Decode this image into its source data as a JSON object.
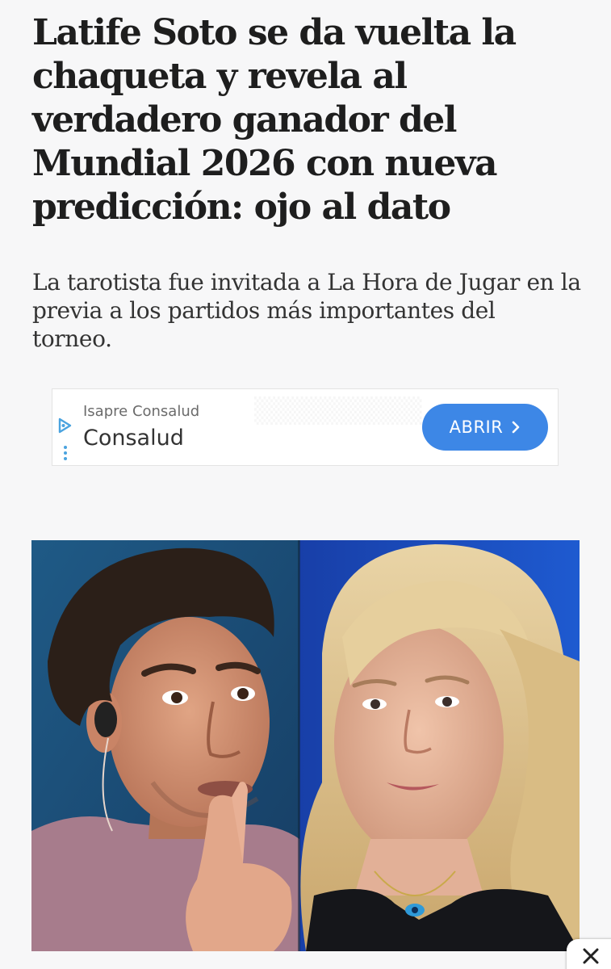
{
  "article": {
    "headline": "Latife Soto se da vuelta la chaqueta y revela al verdadero ganador del Mundial 2026 con nueva predicción: ojo al dato",
    "subheadline": "La tarotista fue invitada a La Hora de Jugar en la previa a los partidos más importantes del torneo."
  },
  "ad": {
    "sponsor": "Isapre Consalud",
    "title": "Consalud",
    "cta_label": "ABRIR",
    "cta_color": "#3d87e6",
    "icons": [
      "ad-choices-icon",
      "chevron-right-icon",
      "more-options-icon"
    ]
  },
  "photo": {
    "description_icons": [
      "man-portrait",
      "woman-portrait"
    ]
  },
  "overlay": {
    "close_icon": "close-icon"
  },
  "colors": {
    "page_background": "#f7f7f8",
    "headline": "#1e1e1e",
    "photo_left_bg": "#1d4f7a",
    "photo_right_bg": "#1a3fa0"
  }
}
